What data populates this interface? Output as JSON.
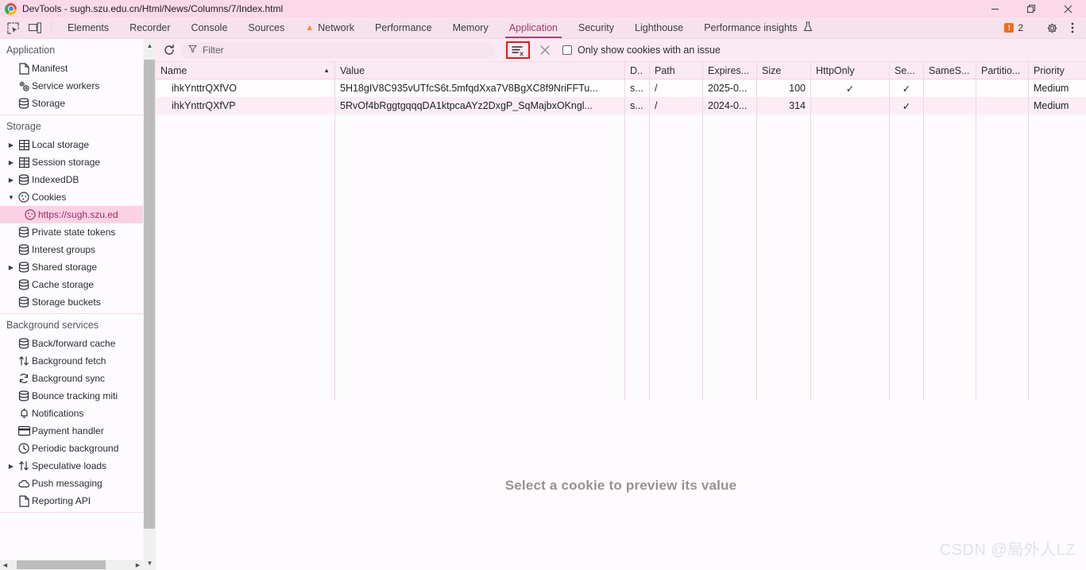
{
  "window": {
    "title": "DevTools - sugh.szu.edu.cn/Html/News/Columns/7/Index.html",
    "minimize_label": "—",
    "restore_label": "❐",
    "close_label": "×"
  },
  "tabbar": {
    "left_tools": [
      {
        "name": "inspect-element-icon",
        "label": ""
      },
      {
        "name": "device-toolbar-icon",
        "label": ""
      }
    ],
    "tabs": [
      {
        "label": "Elements",
        "active": false,
        "warn": false
      },
      {
        "label": "Recorder",
        "active": false,
        "warn": false
      },
      {
        "label": "Console",
        "active": false,
        "warn": false
      },
      {
        "label": "Sources",
        "active": false,
        "warn": false
      },
      {
        "label": "Network",
        "active": false,
        "warn": true
      },
      {
        "label": "Performance",
        "active": false,
        "warn": false
      },
      {
        "label": "Memory",
        "active": false,
        "warn": false
      },
      {
        "label": "Application",
        "active": true,
        "warn": false
      },
      {
        "label": "Security",
        "active": false,
        "warn": false
      },
      {
        "label": "Lighthouse",
        "active": false,
        "warn": false
      },
      {
        "label": "Performance insights",
        "active": false,
        "warn": false,
        "flask": true
      }
    ],
    "error_count": "2",
    "settings_label": "",
    "more_label": ""
  },
  "sidebar": {
    "sections": [
      {
        "title": "Application",
        "items": [
          {
            "label": "Manifest",
            "icon": "document-icon",
            "twisty": "none",
            "selected": false,
            "child": false
          },
          {
            "label": "Service workers",
            "icon": "gears-icon",
            "twisty": "none",
            "selected": false,
            "child": false
          },
          {
            "label": "Storage",
            "icon": "database-icon",
            "twisty": "none",
            "selected": false,
            "child": false
          }
        ]
      },
      {
        "title": "Storage",
        "items": [
          {
            "label": "Local storage",
            "icon": "table-icon",
            "twisty": "collapsed",
            "selected": false,
            "child": false
          },
          {
            "label": "Session storage",
            "icon": "table-icon",
            "twisty": "collapsed",
            "selected": false,
            "child": false
          },
          {
            "label": "IndexedDB",
            "icon": "database-icon",
            "twisty": "collapsed",
            "selected": false,
            "child": false
          },
          {
            "label": "Cookies",
            "icon": "cookie-icon",
            "twisty": "expanded",
            "selected": false,
            "child": false
          },
          {
            "label": "https://sugh.szu.ed",
            "icon": "cookie-icon",
            "twisty": "none",
            "selected": true,
            "child": true
          },
          {
            "label": "Private state tokens",
            "icon": "database-icon",
            "twisty": "none",
            "selected": false,
            "child": false
          },
          {
            "label": "Interest groups",
            "icon": "database-icon",
            "twisty": "none",
            "selected": false,
            "child": false
          },
          {
            "label": "Shared storage",
            "icon": "database-icon",
            "twisty": "collapsed",
            "selected": false,
            "child": false
          },
          {
            "label": "Cache storage",
            "icon": "database-icon",
            "twisty": "none",
            "selected": false,
            "child": false
          },
          {
            "label": "Storage buckets",
            "icon": "database-icon",
            "twisty": "none",
            "selected": false,
            "child": false
          }
        ]
      },
      {
        "title": "Background services",
        "items": [
          {
            "label": "Back/forward cache",
            "icon": "database-icon",
            "twisty": "none",
            "selected": false,
            "child": false
          },
          {
            "label": "Background fetch",
            "icon": "arrows-updown-icon",
            "twisty": "none",
            "selected": false,
            "child": false
          },
          {
            "label": "Background sync",
            "icon": "sync-icon",
            "twisty": "none",
            "selected": false,
            "child": false
          },
          {
            "label": "Bounce tracking miti",
            "icon": "database-icon",
            "twisty": "none",
            "selected": false,
            "child": false
          },
          {
            "label": "Notifications",
            "icon": "bell-icon",
            "twisty": "none",
            "selected": false,
            "child": false
          },
          {
            "label": "Payment handler",
            "icon": "credit-card-icon",
            "twisty": "none",
            "selected": false,
            "child": false
          },
          {
            "label": "Periodic background",
            "icon": "clock-icon",
            "twisty": "none",
            "selected": false,
            "child": false
          },
          {
            "label": "Speculative loads",
            "icon": "arrows-updown-icon",
            "twisty": "collapsed",
            "selected": false,
            "child": false
          },
          {
            "label": "Push messaging",
            "icon": "cloud-icon",
            "twisty": "none",
            "selected": false,
            "child": false
          },
          {
            "label": "Reporting API",
            "icon": "document-icon",
            "twisty": "none",
            "selected": false,
            "child": false
          }
        ]
      }
    ]
  },
  "toolbar": {
    "refresh_label": "",
    "filter_placeholder": "Filter",
    "clear_all_label": "",
    "clear_filtered_label": "",
    "checkbox_label": "Only show cookies with an issue",
    "checkbox_checked": false,
    "highlight_color": "#e8161b"
  },
  "table": {
    "columns": [
      {
        "key": "name",
        "label": "Name",
        "sorted": "asc"
      },
      {
        "key": "value",
        "label": "Value",
        "sorted": ""
      },
      {
        "key": "domain",
        "label": "D..",
        "sorted": ""
      },
      {
        "key": "path",
        "label": "Path",
        "sorted": ""
      },
      {
        "key": "expires",
        "label": "Expires...",
        "sorted": ""
      },
      {
        "key": "size",
        "label": "Size",
        "sorted": ""
      },
      {
        "key": "httponly",
        "label": "HttpOnly",
        "sorted": ""
      },
      {
        "key": "secure",
        "label": "Se...",
        "sorted": ""
      },
      {
        "key": "samesite",
        "label": "SameS...",
        "sorted": ""
      },
      {
        "key": "partition",
        "label": "Partitio...",
        "sorted": ""
      },
      {
        "key": "priority",
        "label": "Priority",
        "sorted": ""
      }
    ],
    "sort_arrow": "▲",
    "check_mark": "✓",
    "rows": [
      {
        "name": "ihkYnttrQXfVO",
        "value": "5H18gIV8C935vUTfcS6t.5mfqdXxa7V8BgXC8f9NriFFTu...",
        "domain": "s...",
        "path": "/",
        "expires": "2025-0...",
        "size": "100",
        "httponly": "✓",
        "secure": "✓",
        "samesite": "",
        "partition": "",
        "priority": "Medium"
      },
      {
        "name": "ihkYnttrQXfVP",
        "value": "5RvOf4bRggtgqqqDA1ktpcaAYz2DxgP_SqMajbxOKngl...",
        "domain": "s...",
        "path": "/",
        "expires": "2024-0...",
        "size": "314",
        "httponly": "",
        "secure": "✓",
        "samesite": "",
        "partition": "",
        "priority": "Medium"
      }
    ]
  },
  "preview": {
    "message": "Select a cookie to preview its value"
  },
  "watermark": {
    "text": "CSDN @局外人LZ"
  }
}
